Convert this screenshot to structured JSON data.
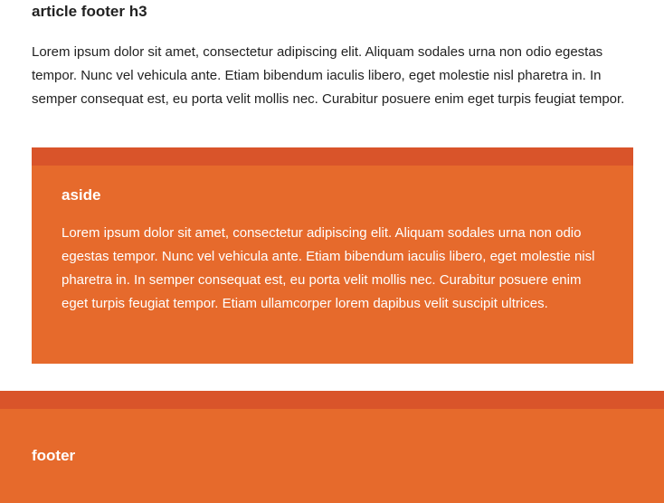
{
  "article_footer": {
    "heading": "article footer h3",
    "paragraph": "Lorem ipsum dolor sit amet, consectetur adipiscing elit. Aliquam sodales urna non odio egestas tempor. Nunc vel vehicula ante. Etiam bibendum iaculis libero, eget molestie nisl pharetra in. In semper consequat est, eu porta velit mollis nec. Curabitur posuere enim eget turpis feugiat tempor."
  },
  "aside": {
    "heading": "aside",
    "paragraph": "Lorem ipsum dolor sit amet, consectetur adipiscing elit. Aliquam sodales urna non odio egestas tempor. Nunc vel vehicula ante. Etiam bibendum iaculis libero, eget molestie nisl pharetra in. In semper consequat est, eu porta velit mollis nec. Curabitur posuere enim eget turpis feugiat tempor. Etiam ullamcorper lorem dapibus velit suscipit ultrices."
  },
  "footer": {
    "label": "footer"
  },
  "colors": {
    "accent": "#e66a2c",
    "accent_dark": "#d9542a",
    "text": "#222222",
    "on_accent": "#ffffff"
  }
}
